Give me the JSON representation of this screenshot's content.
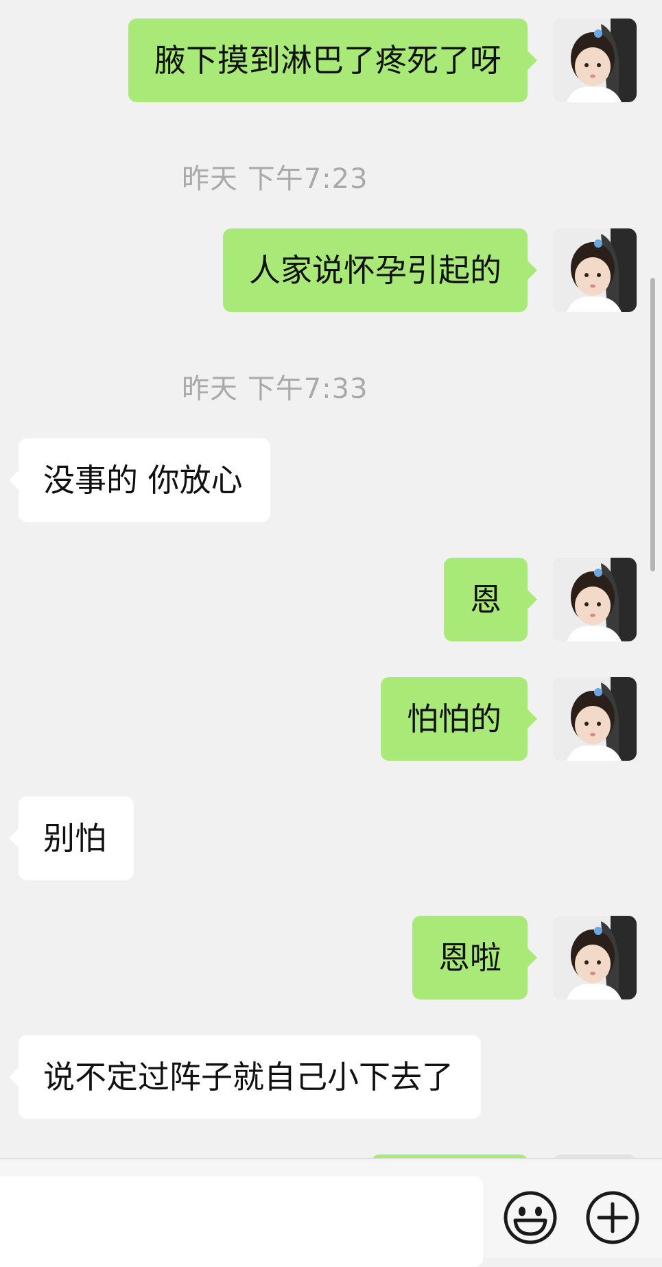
{
  "chat": {
    "messages": [
      {
        "type": "sent",
        "text": "腋下摸到淋巴了疼死了呀"
      },
      {
        "type": "timestamp",
        "text": "昨天 下午7:23"
      },
      {
        "type": "sent",
        "text": "人家说怀孕引起的"
      },
      {
        "type": "timestamp",
        "text": "昨天 下午7:33"
      },
      {
        "type": "received",
        "text": "没事的 你放心"
      },
      {
        "type": "sent",
        "text": "恩"
      },
      {
        "type": "sent",
        "text": "怕怕的"
      },
      {
        "type": "received",
        "text": "别怕"
      },
      {
        "type": "sent",
        "text": "恩啦"
      },
      {
        "type": "received",
        "text": "说不定过阵子就自己小下去了"
      }
    ]
  },
  "input_bar": {
    "text_value": "",
    "emoji_button_icon": "smiley-icon",
    "more_button_icon": "plus-circle-icon"
  },
  "colors": {
    "sent_bubble": "#a9e978",
    "received_bubble": "#ffffff",
    "background": "#f1f1f1",
    "timestamp_text": "#a9a9a9"
  }
}
